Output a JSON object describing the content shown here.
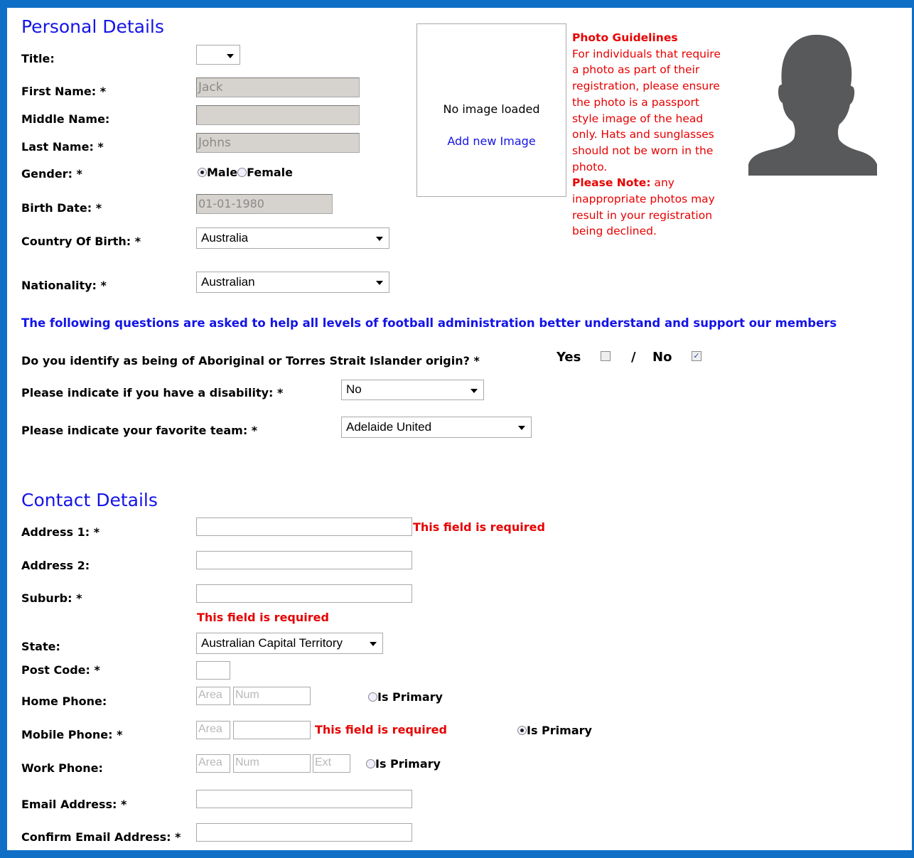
{
  "personal": {
    "heading": "Personal Details",
    "title_label": "Title:",
    "first_name_label": "First Name: *",
    "first_name_value": "Jack",
    "middle_name_label": "Middle Name:",
    "last_name_label": "Last Name: *",
    "last_name_value": "Johns",
    "gender_label": "Gender: *",
    "gender_male": "Male",
    "gender_female": "Female",
    "gender_selected": "Male",
    "birth_date_label": "Birth Date: *",
    "birth_date_value": "01-01-1980",
    "country_label": "Country Of Birth: *",
    "country_value": "Australia",
    "nationality_label": "Nationality: *",
    "nationality_value": "Australian"
  },
  "photo": {
    "no_image": "No image loaded",
    "add_image": "Add new Image",
    "guidelines_title": "Photo Guidelines",
    "guidelines_lines": [
      "For individuals that require",
      "a photo as part of their",
      "registration, please ensure",
      "the photo is a passport",
      "style image of the head",
      "only. Hats and sunglasses",
      "should not be worn in the",
      "photo."
    ],
    "note_bold": "Please Note:",
    "note_lines": [
      " any",
      "inappropriate photos may",
      "result in your registration",
      "being declined."
    ],
    "silhouette_icon": "person-silhouette-icon"
  },
  "questions": {
    "intro": "The following questions are asked to help all levels of football administration better understand and support our members",
    "aboriginal_label": "Do you identify as being of Aboriginal or Torres Strait Islander origin? *",
    "yes_label": "Yes",
    "slash": "/",
    "no_label": "No",
    "yes_checked": false,
    "no_checked": true,
    "disability_label": "Please indicate if you have a disability: *",
    "disability_value": "No",
    "team_label": "Please indicate your favorite team: *",
    "team_value": "Adelaide United"
  },
  "contact": {
    "heading": "Contact Details",
    "address1_label": "Address 1: *",
    "address2_label": "Address 2:",
    "suburb_label": "Suburb: *",
    "state_label": "State:",
    "state_value": "Australian Capital Territory",
    "postcode_label": "Post Code: *",
    "home_phone_label": "Home Phone:",
    "mobile_phone_label": "Mobile Phone: *",
    "work_phone_label": "Work Phone:",
    "email_label": "Email Address: *",
    "confirm_email_label": "Confirm Email Address: *",
    "area_placeholder": "Area",
    "num_placeholder": "Num",
    "ext_placeholder": "Ext",
    "is_primary": "Is Primary",
    "primary_selected": "mobile",
    "required_error": "This field is required"
  },
  "colors": {
    "frame": "#0f6fc6",
    "heading_blue": "#1414e6",
    "error_red": "#e60000"
  }
}
